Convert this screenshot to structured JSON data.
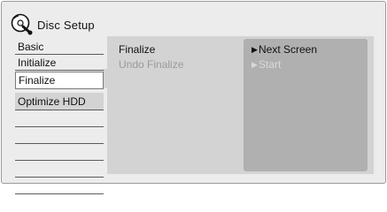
{
  "header": {
    "title": "Disc Setup",
    "icon": "disc-setup-icon"
  },
  "menu": {
    "items": [
      {
        "label": "Basic"
      },
      {
        "label": "Initialize"
      },
      {
        "label": "Finalize"
      },
      {
        "label": "Optimize HDD"
      }
    ],
    "selected": "Finalize"
  },
  "sub_menu": {
    "items": [
      {
        "label": "Finalize",
        "enabled": true
      },
      {
        "label": "Undo Finalize",
        "enabled": false
      }
    ]
  },
  "options": {
    "items": [
      {
        "label": "Next Screen",
        "enabled": true
      },
      {
        "label": "Start",
        "enabled": false
      }
    ]
  },
  "colors": {
    "frame": "#ececec",
    "panel": "#d3d3d3",
    "options_panel": "#b0b0b0",
    "disabled_text": "#9a9a9a"
  }
}
